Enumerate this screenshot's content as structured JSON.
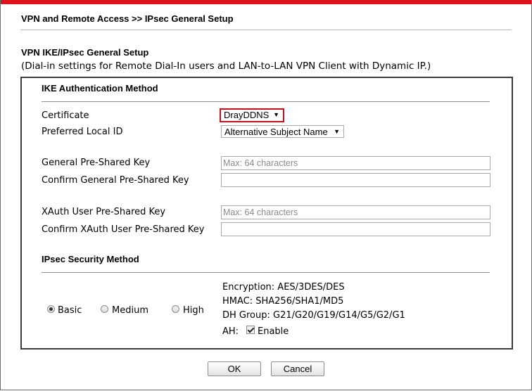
{
  "header": {
    "title": "VPN and Remote Access >> IPsec General Setup"
  },
  "section": {
    "title": "VPN IKE/IPsec General Setup",
    "subtitle": "(Dial-in settings for Remote Dial-In users and LAN-to-LAN VPN Client with Dynamic IP.)"
  },
  "ike": {
    "title": "IKE Authentication Method",
    "certificate_label": "Certificate",
    "certificate_value": "DrayDDNS",
    "local_id_label": "Preferred Local ID",
    "local_id_value": "Alternative Subject Name",
    "general_psk_label": "General Pre-Shared Key",
    "general_psk_placeholder": "Max: 64 characters",
    "confirm_general_psk_label": "Confirm General Pre-Shared Key",
    "xauth_psk_label": "XAuth User Pre-Shared Key",
    "xauth_psk_placeholder": "Max: 64 characters",
    "confirm_xauth_psk_label": "Confirm XAuth User Pre-Shared Key"
  },
  "ipsec": {
    "title": "IPsec Security Method",
    "options": {
      "basic": "Basic",
      "medium": "Medium",
      "high": "High"
    },
    "selected": "Basic",
    "encryption": "Encryption: AES/3DES/DES",
    "hmac": "HMAC: SHA256/SHA1/MD5",
    "dh_group": "DH Group: G21/G20/G19/G14/G5/G2/G1",
    "ah_label": "AH:",
    "ah_enable_label": "Enable",
    "ah_enabled": true
  },
  "footer": {
    "ok_label": "OK",
    "cancel_label": "Cancel"
  },
  "colors": {
    "accent": "#e0121b",
    "border": "#3a3a3a"
  }
}
